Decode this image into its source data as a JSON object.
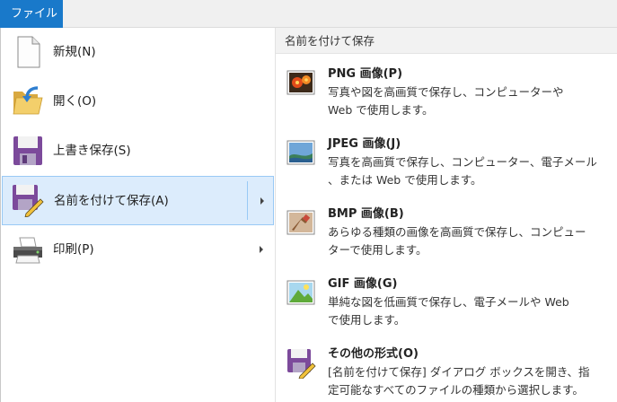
{
  "menubar": {
    "file_tab": "ファイル"
  },
  "menu": {
    "items": [
      {
        "name": "new",
        "label": "新規(N)"
      },
      {
        "name": "open",
        "label": "開く(O)"
      },
      {
        "name": "save",
        "label": "上書き保存(S)"
      },
      {
        "name": "save-as",
        "label": "名前を付けて保存(A)",
        "selected": true,
        "has_submenu": true
      },
      {
        "name": "print",
        "label": "印刷(P)",
        "has_submenu": true
      }
    ]
  },
  "submenu": {
    "header": "名前を付けて保存",
    "items": [
      {
        "name": "png",
        "title": "PNG 画像(P)",
        "desc_lines": [
          "写真や図を高画質で保存し、コンピューターや",
          "Web で使用します。"
        ]
      },
      {
        "name": "jpeg",
        "title": "JPEG 画像(J)",
        "desc_lines": [
          "写真を高画質で保存し、コンピューター、電子メール",
          "、または Web で使用します。"
        ]
      },
      {
        "name": "bmp",
        "title": "BMP 画像(B)",
        "desc_lines": [
          "あらゆる種類の画像を高画質で保存し、コンピュー",
          "ターで使用します。"
        ]
      },
      {
        "name": "gif",
        "title": "GIF 画像(G)",
        "desc_lines": [
          "単純な図を低画質で保存し、電子メールや Web",
          "で使用します。"
        ]
      },
      {
        "name": "other",
        "title": "その他の形式(O)",
        "desc_lines": [
          "[名前を付けて保存] ダイアログ ボックスを開き、指",
          "定可能なすべてのファイルの種類から選択します。"
        ]
      }
    ]
  },
  "colors": {
    "accent": "#1979ca",
    "selected_bg": "#dcecfc",
    "selected_border": "#99c9f5"
  }
}
